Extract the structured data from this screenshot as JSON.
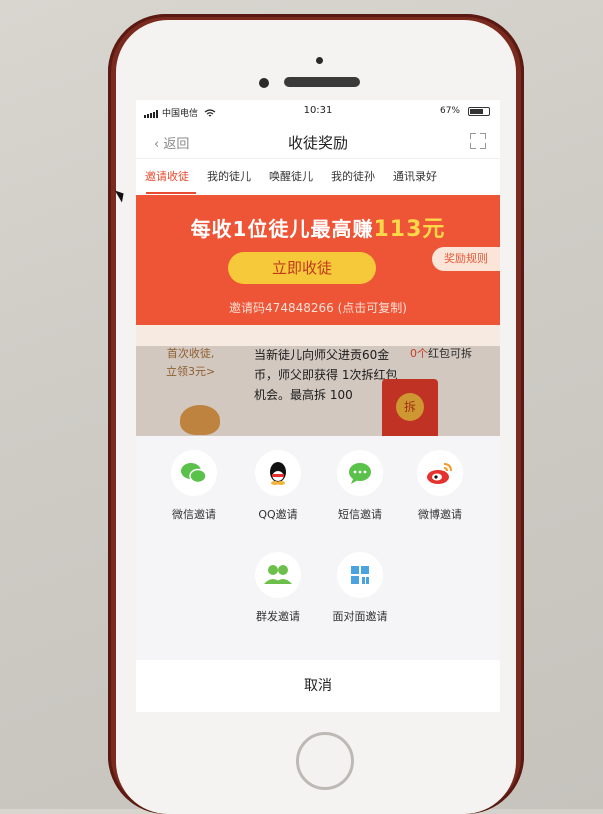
{
  "status_bar": {
    "carrier": "中国电信",
    "time": "10:31",
    "battery": "67%",
    "battery_level": 0.67
  },
  "nav": {
    "back_label": "返回",
    "title": "收徒奖励"
  },
  "tabs": [
    {
      "label": "邀请收徒",
      "active": true
    },
    {
      "label": "我的徒儿",
      "active": false
    },
    {
      "label": "唤醒徒儿",
      "active": false
    },
    {
      "label": "我的徒孙",
      "active": false
    },
    {
      "label": "通讯录好",
      "active": false
    }
  ],
  "banner": {
    "headline_prefix": "每收1位徒儿最高赚",
    "headline_amount": "113元",
    "invite_button": "立即收徒",
    "rules_button": "奖励规则",
    "invite_code": "邀请码474848266 (点击可复制)"
  },
  "promo": {
    "left_line1": "首次收徒,",
    "left_line2": "立领3元>",
    "description": "当新徒儿向师父进贡60金币，师父即获得 1次拆红包机会。最高拆 100",
    "count": "0个",
    "count_suffix": "红包可拆",
    "envelope_seal": "拆"
  },
  "share_sheet": {
    "items": [
      {
        "label": "微信邀请",
        "icon": "wechat-icon"
      },
      {
        "label": "QQ邀请",
        "icon": "qq-icon"
      },
      {
        "label": "短信邀请",
        "icon": "sms-icon"
      },
      {
        "label": "微博邀请",
        "icon": "weibo-icon"
      },
      {
        "label": "群发邀请",
        "icon": "group-icon"
      },
      {
        "label": "面对面邀请",
        "icon": "qrcode-icon"
      }
    ],
    "cancel_label": "取消"
  },
  "colors": {
    "accent": "#e84b2e",
    "banner": "#ee5436",
    "button_yellow": "#f6c93b",
    "wechat_green": "#5ac14a",
    "weibo_red": "#e6322e",
    "qrcode_blue": "#4aa3df"
  }
}
